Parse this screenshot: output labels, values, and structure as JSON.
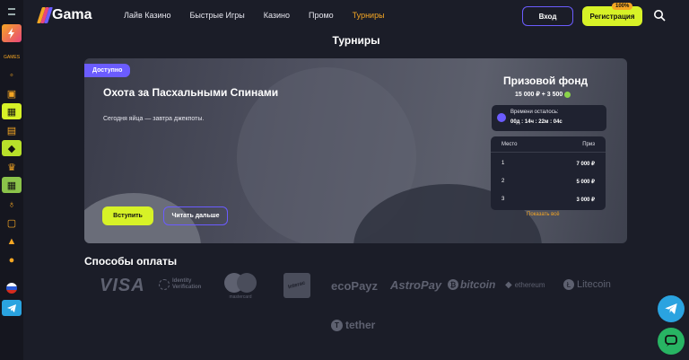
{
  "header": {
    "logo_text": "Gama",
    "nav": [
      "Лайв Казино",
      "Быстрые Игры",
      "Казино",
      "Промо",
      "Турниры"
    ],
    "active_nav": "Турниры",
    "login_label": "Вход",
    "register_label": "Регистрация",
    "register_badge": "100%"
  },
  "page": {
    "title": "Турниры"
  },
  "tournament": {
    "status_tag": "Доступно",
    "title": "Охота за Пасхальными Спинами",
    "subtitle": "Сегодня яйца — завтра джекпоты.",
    "join_label": "Вступить",
    "more_label": "Читать дальше",
    "prize_title": "Призовой фонд",
    "prize_value": "15 000 ₽ + 3 500",
    "timer_label": "Времени осталось:",
    "timer_value": "00д : 14ч : 22м : 04с",
    "table_headers": [
      "Место",
      "Приз"
    ],
    "places": [
      {
        "place": "1",
        "prize": "7 000 ₽"
      },
      {
        "place": "2",
        "prize": "5 000 ₽"
      },
      {
        "place": "3",
        "prize": "3 000 ₽"
      }
    ],
    "show_all_label": "Показать всё"
  },
  "payments": {
    "title": "Способы оплаты",
    "methods": [
      "VISA",
      "Identity Verification",
      "mastercard",
      "Interac",
      "ecoPayz",
      "AstroPay",
      "bitcoin",
      "ethereum",
      "Litecoin",
      "tether"
    ]
  },
  "colors": {
    "accent": "#6b5cff",
    "cta": "#d7f227",
    "orange": "#f5a623",
    "bg": "#1b1d28"
  },
  "icons": {
    "rail": [
      "menu-icon",
      "lightning-icon",
      "promo-label-icon",
      "badge-icon",
      "chest-icon",
      "gift-icon",
      "gift-box-icon",
      "ticket-icon",
      "trophy-icon",
      "calendar-icon",
      "bulb-icon",
      "chat-icon",
      "android-icon",
      "apple-icon",
      "russia-flag-icon",
      "telegram-icon"
    ],
    "floating": [
      "telegram-icon",
      "chat-bubble-icon"
    ]
  }
}
